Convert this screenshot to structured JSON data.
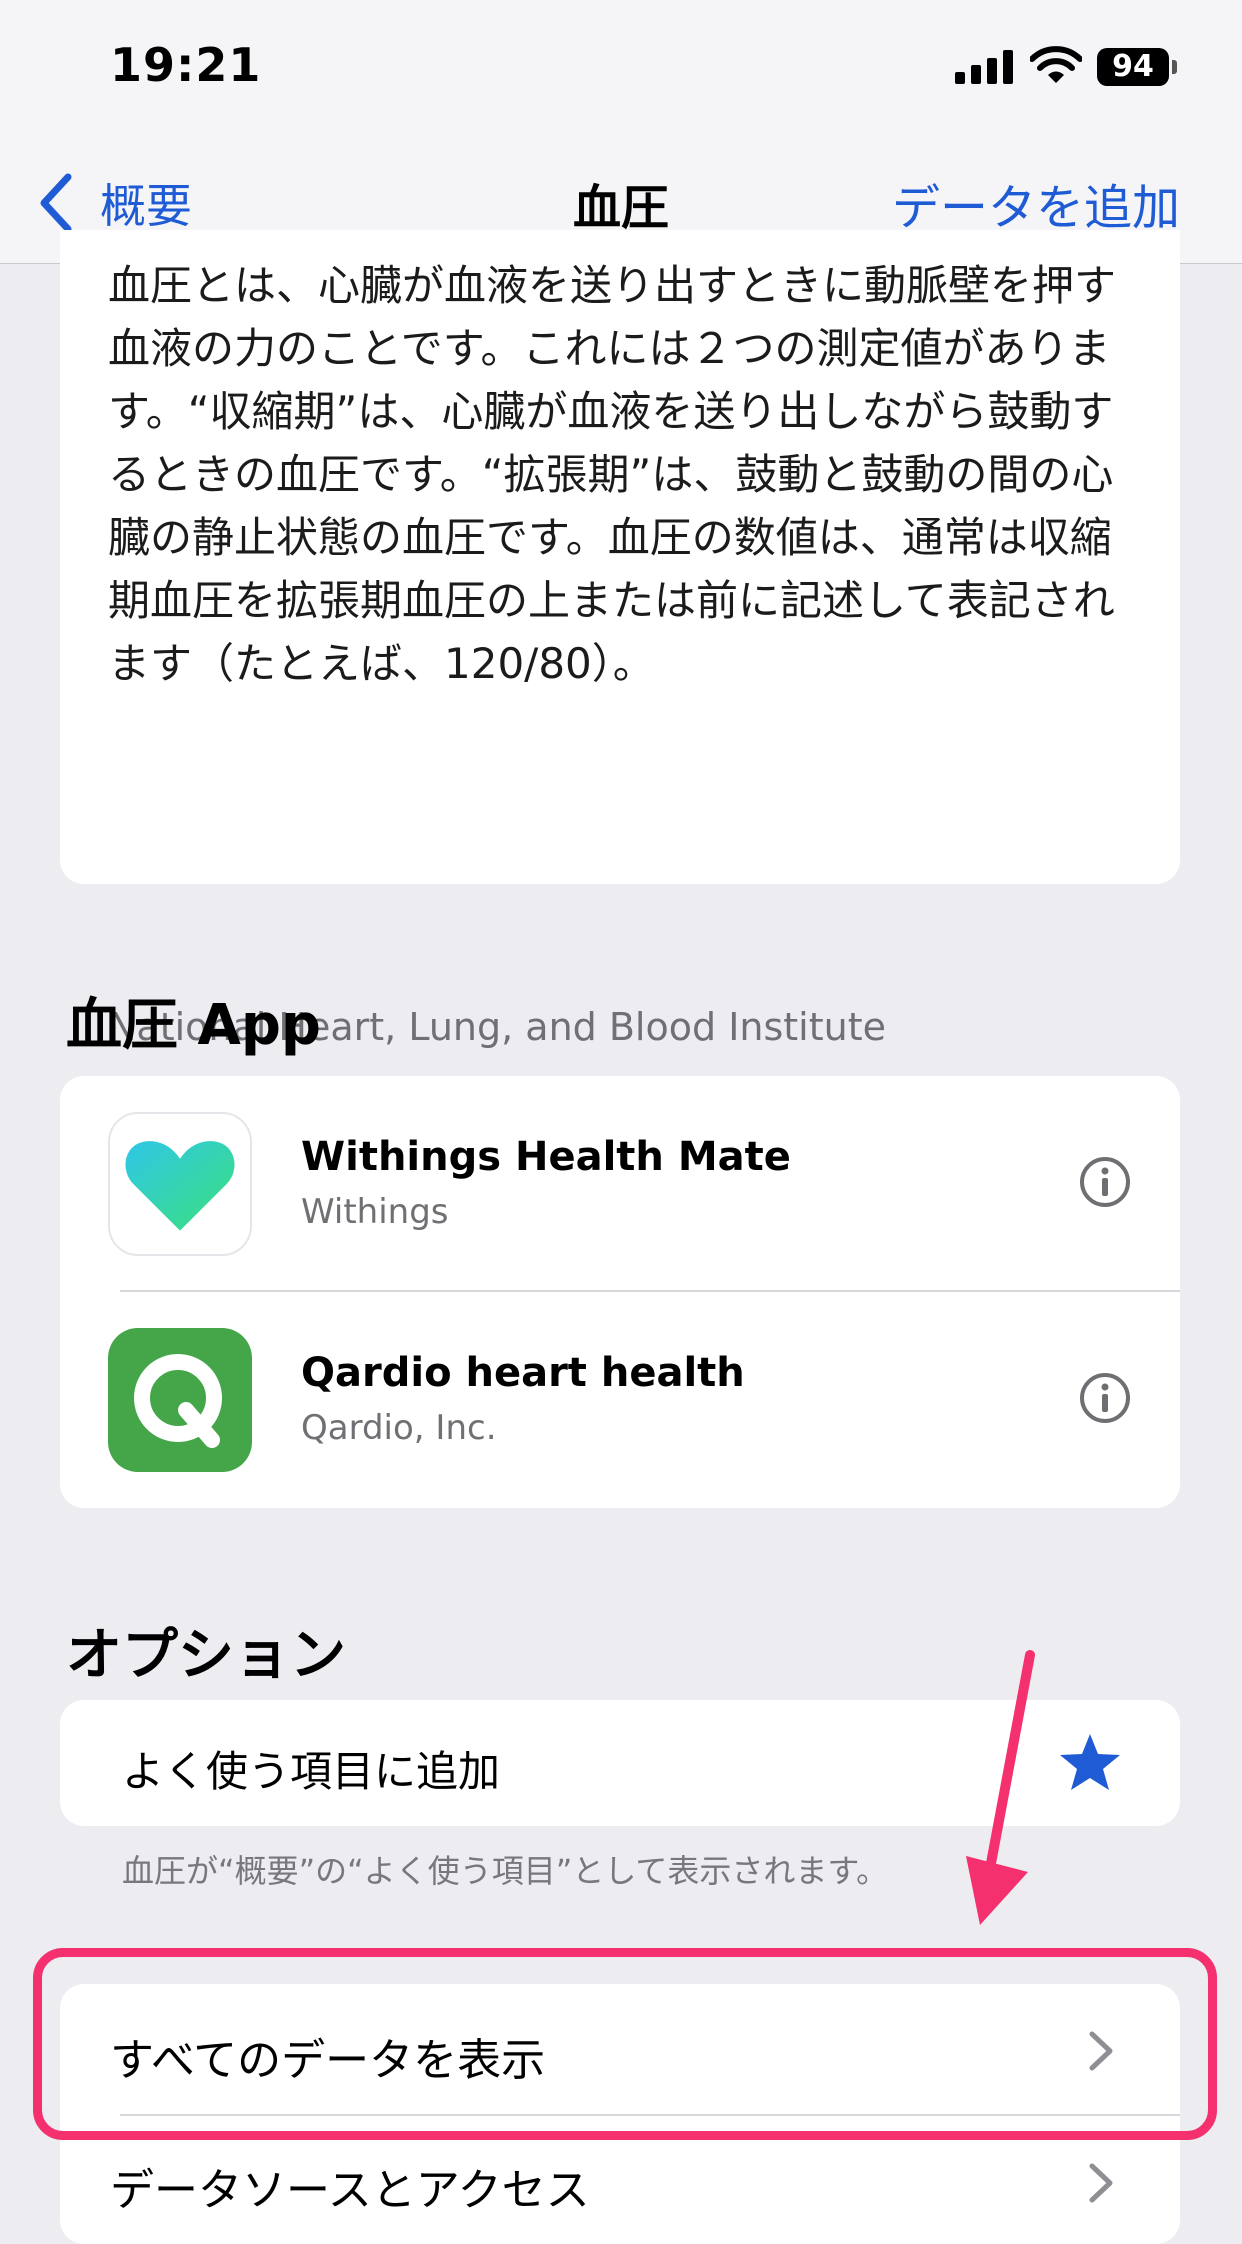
{
  "status_bar": {
    "time": "19:21",
    "battery": "94"
  },
  "nav": {
    "back_label": "概要",
    "title": "血圧",
    "action_label": "データを追加"
  },
  "description": {
    "text": "血圧とは、心臓が血液を送り出すときに動脈壁を押す血液の力のことです。これには２つの測定値があります。“収縮期”は、心臓が血液を送り出しながら鼓動するときの血圧です。“拡張期”は、鼓動と鼓動の間の心臓の静止状態の血圧です。血圧の数値は、通常は収縮期血圧を拡張期血圧の上または前に記述して表記されます（たとえば、120/80）。",
    "source": "National Heart, Lung, and Blood Institute"
  },
  "apps_section": {
    "title": "血圧 App",
    "apps": [
      {
        "name": "Withings Health Mate",
        "vendor": "Withings",
        "icon": "heart-logo-icon"
      },
      {
        "name": "Qardio heart health",
        "vendor": "Qardio, Inc.",
        "icon": "q-logo-icon"
      }
    ]
  },
  "options_section": {
    "title": "オプション",
    "favorite_label": "よく使う項目に追加",
    "favorite_note": "血圧が“概要”の“よく使う項目”として表示されます。",
    "show_all_label": "すべてのデータを表示",
    "sources_label": "データソースとアクセス"
  },
  "colors": {
    "accent": "#1f5bd4",
    "highlight": "#f5306e",
    "background": "#ececf1"
  }
}
